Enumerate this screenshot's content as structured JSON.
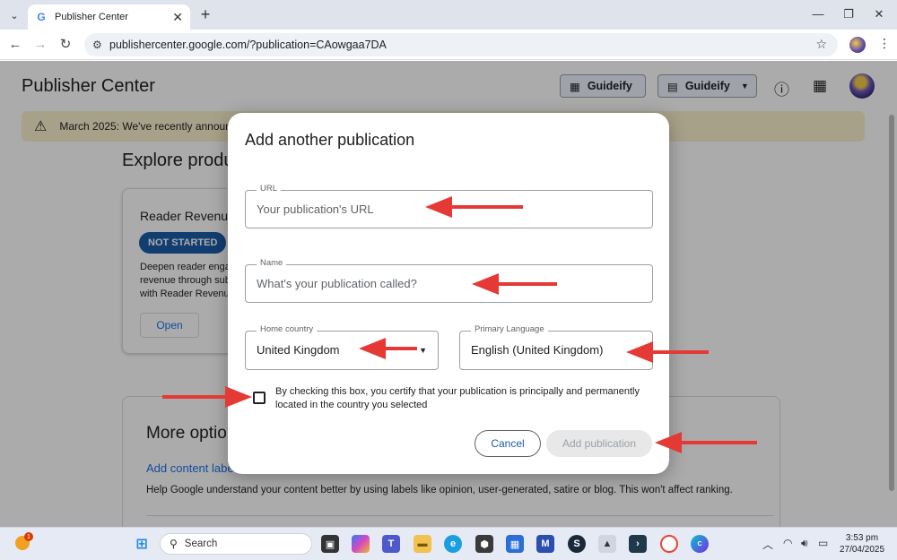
{
  "browser": {
    "tab_title": "Publisher Center",
    "favicon": "G",
    "url": "publishercenter.google.com/?publication=CAowgaa7DA"
  },
  "page": {
    "title": "Publisher Center",
    "header_buttons": [
      "Guideify",
      "Guideify"
    ],
    "banner_text": "March 2025: We've recently announc",
    "explore_heading": "Explore produ",
    "card": {
      "title": "Reader Revenue",
      "badge": "NOT STARTED",
      "desc_lines": [
        "Deepen reader enga",
        "revenue through sub",
        "with Reader Revenu"
      ],
      "open_label": "Open"
    },
    "more": {
      "heading": "More optio",
      "link": "Add content label",
      "help": "Help Google understand your content better by using labels like opinion, user-generated, satire or blog. This won't affect ranking."
    }
  },
  "dialog": {
    "title": "Add another publication",
    "url_label": "URL",
    "url_placeholder": "Your publication's URL",
    "name_label": "Name",
    "name_placeholder": "What's your publication called?",
    "country_label": "Home country",
    "country_value": "United Kingdom",
    "language_label": "Primary Language",
    "language_value": "English (United Kingdom)",
    "certify_text": "By checking this box, you certify that your publication is principally and permanently located in the country you selected",
    "cancel_label": "Cancel",
    "add_label": "Add publication"
  },
  "taskbar": {
    "search_placeholder": "Search",
    "weather_badge": "1",
    "time": "3:53 pm",
    "date": "27/04/2025"
  },
  "colors": {
    "arrow": "#e53935",
    "primary": "#1a5ca8",
    "banner": "#fbf0cc"
  }
}
